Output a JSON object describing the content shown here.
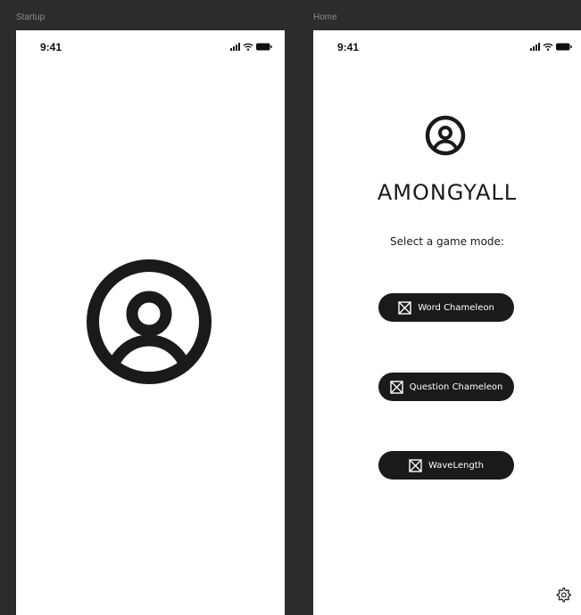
{
  "frames": {
    "startup": {
      "label": "Startup",
      "status_time": "9:41",
      "logo_icon": "user-circle-icon"
    },
    "home": {
      "label": "Home",
      "status_time": "9:41",
      "logo_icon": "user-circle-icon",
      "app_title": "AMONGYALL",
      "subtitle": "Select a game mode:",
      "mode_buttons": [
        {
          "label": "Word Chameleon",
          "icon": "placeholder-image-icon"
        },
        {
          "label": "Question Chameleon",
          "icon": "placeholder-image-icon"
        },
        {
          "label": "WaveLength",
          "icon": "placeholder-image-icon"
        }
      ],
      "settings_icon": "gear-icon"
    }
  },
  "colors": {
    "canvas_background": "#2c2c2c",
    "screen_background": "#ffffff",
    "button_background": "#1a1a1a",
    "button_text": "#ffffff",
    "icon_color": "#1a1a1a"
  }
}
